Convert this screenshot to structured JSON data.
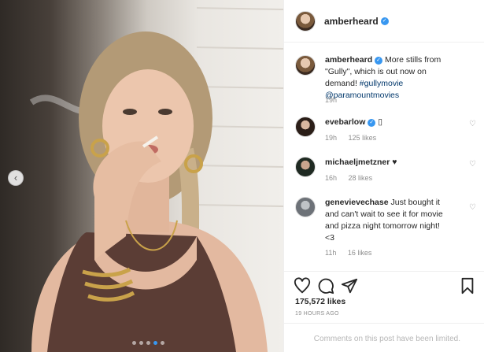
{
  "post": {
    "username": "amberheard",
    "verified": true,
    "caption": {
      "text": "More stills from \"Gully\", which is out now on demand!",
      "hashtag": "#gullymovie",
      "mention": "@paramountmovies",
      "age": "19h"
    },
    "likes": "175,572 likes",
    "timestamp": "19 HOURS AGO",
    "footer_note": "Comments on this post have been limited.",
    "carousel": {
      "slides": 5,
      "active_index": 4
    }
  },
  "comments": [
    {
      "username": "evebarlow",
      "verified": true,
      "text": "▯",
      "age": "19h",
      "likes": "125 likes"
    },
    {
      "username": "michaeljmetzner",
      "verified": false,
      "text": "♥",
      "age": "16h",
      "likes": "28 likes"
    },
    {
      "username": "genevievechase",
      "verified": false,
      "text": "Just bought it and can't wait to see it for movie and pizza night tomorrow night! <3",
      "age": "11h",
      "likes": "16 likes"
    }
  ],
  "icons": {
    "like": "heart-icon",
    "comment": "comment-icon",
    "share": "share-icon",
    "save": "bookmark-icon",
    "verified": "verified-badge-icon",
    "prev": "chevron-left-icon"
  },
  "colors": {
    "accent": "#3897f0",
    "link": "#00376b",
    "muted": "#8e8e8e",
    "text": "#262626"
  }
}
